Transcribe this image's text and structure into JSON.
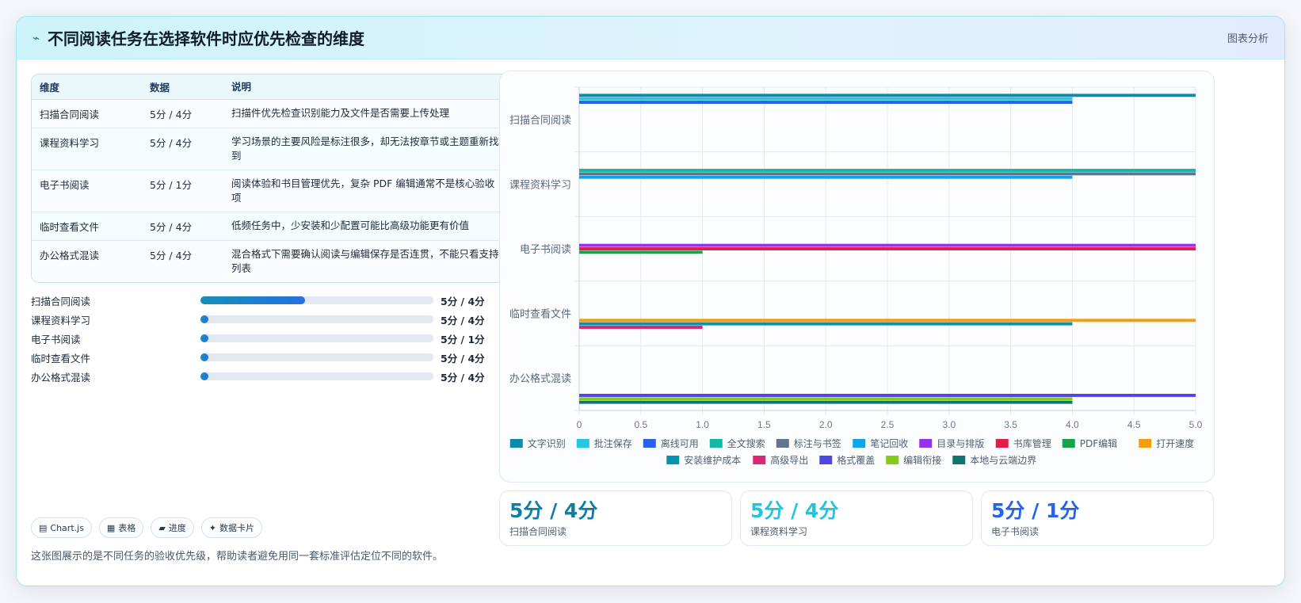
{
  "header": {
    "title": "不同阅读任务在选择软件时应优先检查的维度",
    "tag": "图表分析",
    "icon": "spark-icon"
  },
  "table": {
    "headers": [
      "维度",
      "数据",
      "说明"
    ],
    "rows": [
      {
        "name": "扫描合同阅读",
        "data": "5分 / 4分",
        "desc": "扫描件优先检查识别能力及文件是否需要上传处理"
      },
      {
        "name": "课程资料学习",
        "data": "5分 / 4分",
        "desc": "学习场景的主要风险是标注很多，却无法按章节或主题重新找到"
      },
      {
        "name": "电子书阅读",
        "data": "5分 / 1分",
        "desc": "阅读体验和书目管理优先，复杂 PDF 编辑通常不是核心验收项"
      },
      {
        "name": "临时查看文件",
        "data": "5分 / 4分",
        "desc": "低频任务中，少安装和少配置可能比高级功能更有价值"
      },
      {
        "name": "办公格式混读",
        "data": "5分 / 4分",
        "desc": "混合格式下需要确认阅读与编辑保存是否连贯，不能只看支持列表"
      }
    ]
  },
  "progress": [
    {
      "label": "扫描合同阅读",
      "value": "5分 / 4分",
      "fill": 0.45
    },
    {
      "label": "课程资料学习",
      "value": "5分 / 4分",
      "fill": 0
    },
    {
      "label": "电子书阅读",
      "value": "5分 / 1分",
      "fill": 0
    },
    {
      "label": "临时查看文件",
      "value": "5分 / 4分",
      "fill": 0
    },
    {
      "label": "办公格式混读",
      "value": "5分 / 4分",
      "fill": 0
    }
  ],
  "chips": [
    {
      "icon": "chart-icon",
      "glyph": "▤",
      "label": "Chart.js"
    },
    {
      "icon": "table-icon",
      "glyph": "▦",
      "label": "表格"
    },
    {
      "icon": "progress-icon",
      "glyph": "▰",
      "label": "进度"
    },
    {
      "icon": "card-icon",
      "glyph": "✦",
      "label": "数据卡片"
    }
  ],
  "footnote": "这张图展示的是不同任务的验收优先级，帮助读者避免用同一套标准评估定位不同的软件。",
  "stats": [
    {
      "value": "5分 / 4分",
      "label": "扫描合同阅读",
      "color": "#0e7fa4"
    },
    {
      "value": "5分 / 4分",
      "label": "课程资料学习",
      "color": "#22c5dd"
    },
    {
      "value": "5分 / 1分",
      "label": "电子书阅读",
      "color": "#2563eb"
    }
  ],
  "chart_data": {
    "type": "bar",
    "orientation": "horizontal",
    "categories": [
      "扫描合同阅读",
      "课程资料学习",
      "电子书阅读",
      "临时查看文件",
      "办公格式混读"
    ],
    "xlim": [
      0,
      5
    ],
    "xticks": [
      "0",
      "0.5",
      "1.0",
      "1.5",
      "2.0",
      "2.5",
      "3.0",
      "3.5",
      "4.0",
      "4.5",
      "5.0"
    ],
    "grid": true,
    "legend_position": "bottom",
    "series": [
      {
        "name": "文字识别",
        "color": "#0e8ba8",
        "values": [
          5,
          null,
          null,
          null,
          null
        ]
      },
      {
        "name": "批注保存",
        "color": "#22c7e0",
        "values": [
          4,
          null,
          null,
          null,
          null
        ]
      },
      {
        "name": "离线可用",
        "color": "#2563eb",
        "values": [
          4,
          null,
          null,
          null,
          null
        ]
      },
      {
        "name": "全文搜索",
        "color": "#14b8a6",
        "values": [
          null,
          5,
          null,
          null,
          null
        ]
      },
      {
        "name": "标注与书签",
        "color": "#64748b",
        "values": [
          null,
          5,
          null,
          null,
          null
        ]
      },
      {
        "name": "笔记回收",
        "color": "#0ea5e9",
        "values": [
          null,
          4,
          null,
          null,
          null
        ]
      },
      {
        "name": "目录与排版",
        "color": "#9333ea",
        "values": [
          null,
          null,
          5,
          null,
          null
        ]
      },
      {
        "name": "书库管理",
        "color": "#e11d48",
        "values": [
          null,
          null,
          5,
          null,
          null
        ]
      },
      {
        "name": "PDF编辑",
        "color": "#16a34a",
        "values": [
          null,
          null,
          1,
          null,
          null
        ]
      },
      {
        "name": "打开速度",
        "color": "#f59e0b",
        "values": [
          null,
          null,
          null,
          5,
          null
        ]
      },
      {
        "name": "安装维护成本",
        "color": "#0891b2",
        "values": [
          null,
          null,
          null,
          4,
          null
        ]
      },
      {
        "name": "高级导出",
        "color": "#db2777",
        "values": [
          null,
          null,
          null,
          1,
          null
        ]
      },
      {
        "name": "格式覆盖",
        "color": "#4f46e5",
        "values": [
          null,
          null,
          null,
          null,
          5
        ]
      },
      {
        "name": "编辑衔接",
        "color": "#84cc16",
        "values": [
          null,
          null,
          null,
          null,
          4
        ]
      },
      {
        "name": "本地与云端边界",
        "color": "#0f766e",
        "values": [
          null,
          null,
          null,
          null,
          4
        ]
      }
    ]
  }
}
